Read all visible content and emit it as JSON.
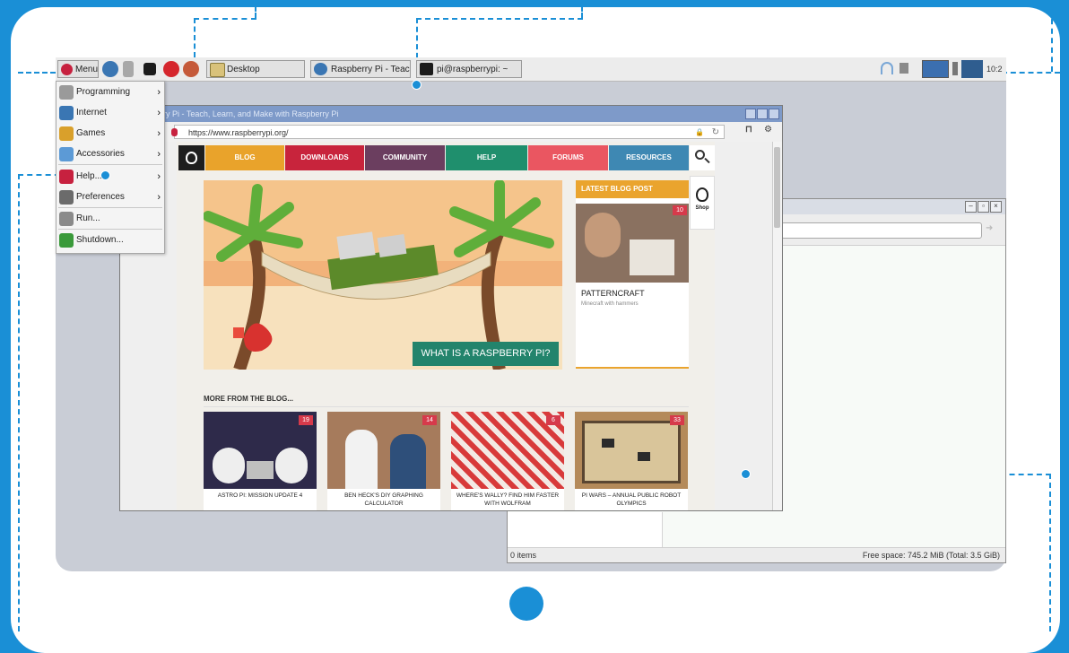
{
  "taskbar": {
    "menu_label": "Menu",
    "tasks": [
      {
        "label": "Desktop"
      },
      {
        "label": "Raspberry Pi - Teach,"
      },
      {
        "label": "pi@raspberrypi: ~"
      }
    ],
    "clock": "10:2"
  },
  "app_menu": {
    "items": [
      {
        "label": "Programming",
        "icon": "programming-icon",
        "submenu": true
      },
      {
        "label": "Internet",
        "icon": "globe-icon",
        "submenu": true
      },
      {
        "label": "Games",
        "icon": "games-icon",
        "submenu": true
      },
      {
        "label": "Accessories",
        "icon": "accessories-icon",
        "submenu": true
      },
      {
        "label": "Help...",
        "icon": "help-icon",
        "submenu": true
      },
      {
        "label": "Preferences",
        "icon": "preferences-icon",
        "submenu": true
      },
      {
        "label": "Run...",
        "icon": "run-icon",
        "submenu": false
      },
      {
        "label": "Shutdown...",
        "icon": "shutdown-icon",
        "submenu": false
      }
    ]
  },
  "browser": {
    "title": "rry Pi - Teach, Learn, and Make with Raspberry Pi",
    "url": "https://www.raspberrypi.org/",
    "nav": [
      {
        "label": "BLOG",
        "color": "#e9a32b"
      },
      {
        "label": "DOWNLOADS",
        "color": "#c8243c"
      },
      {
        "label": "COMMUNITY",
        "color": "#6b3e5f"
      },
      {
        "label": "HELP",
        "color": "#1f8f6d"
      },
      {
        "label": "FORUMS",
        "color": "#ea5661"
      },
      {
        "label": "RESOURCES",
        "color": "#3e88b3"
      }
    ],
    "hero_cta": "WHAT IS A RASPBERRY PI?",
    "latest": {
      "heading": "LATEST BLOG POST",
      "badge": "10",
      "title": "PATTERNCRAFT",
      "subtitle": "Minecraft with hammers"
    },
    "shop_label": "Shop",
    "more_heading": "MORE FROM THE BLOG...",
    "cards": [
      {
        "badge": "19",
        "caption": "ASTRO PI: MISSION UPDATE 4"
      },
      {
        "badge": "14",
        "caption": "BEN HECK'S DIY GRAPHING CALCULATOR"
      },
      {
        "badge": "6",
        "caption": "WHERE'S WALLY? FIND HIM FASTER WITH WOLFRAM"
      },
      {
        "badge": "33",
        "caption": "PI WARS – ANNUAL PUBLIC ROBOT OLYMPICS"
      }
    ]
  },
  "file_manager": {
    "status_left": "0 items",
    "status_right": "Free space: 745.2 MiB (Total: 3.5 GiB)"
  },
  "colors": {
    "accent": "#1a8fd6",
    "desktop": "#c9cdd6",
    "browser_titlebar": "#7e9ac9"
  }
}
